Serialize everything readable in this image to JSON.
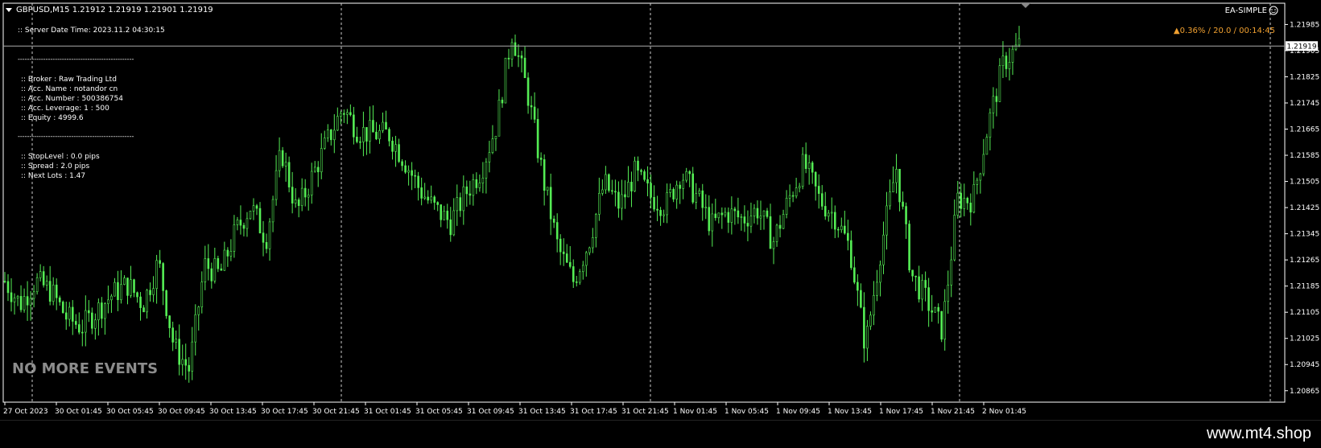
{
  "chart_data": {
    "type": "candlestick",
    "symbol_line": "GBPUSD,M15  1.21912 1.21919 1.21901 1.21919",
    "current_price": 1.21919,
    "current_price_label": "1.21919",
    "ylim": [
      1.2083,
      1.2205
    ],
    "y_ticks": [
      "1.21985",
      "1.21905",
      "1.21825",
      "1.21745",
      "1.21665",
      "1.21585",
      "1.21505",
      "1.21425",
      "1.21345",
      "1.21265",
      "1.21185",
      "1.21105",
      "1.21025",
      "1.20945",
      "1.20865"
    ],
    "x_ticks": [
      "27 Oct 2023",
      "30 Oct 01:45",
      "30 Oct 05:45",
      "30 Oct 09:45",
      "30 Oct 13:45",
      "30 Oct 17:45",
      "30 Oct 21:45",
      "31 Oct 01:45",
      "31 Oct 05:45",
      "31 Oct 09:45",
      "31 Oct 13:45",
      "31 Oct 17:45",
      "31 Oct 21:45",
      "1 Nov 01:45",
      "1 Nov 05:45",
      "1 Nov 09:45",
      "1 Nov 13:45",
      "1 Nov 17:45",
      "1 Nov 21:45",
      "2 Nov 01:45"
    ],
    "closes": [
      1.212,
      1.2113,
      1.212,
      1.2117,
      1.2109,
      1.2106,
      1.2111,
      1.2116,
      1.2119,
      1.2113,
      1.2126,
      1.21,
      1.2093,
      1.2125,
      1.2122,
      1.2135,
      1.2143,
      1.2133,
      1.216,
      1.2141,
      1.2152,
      1.2163,
      1.2173,
      1.2166,
      1.2165,
      1.2165,
      1.2157,
      1.2148,
      1.2142,
      1.2138,
      1.2147,
      1.2154,
      1.2168,
      1.2196,
      1.2178,
      1.2152,
      1.213,
      1.212,
      1.2132,
      1.215,
      1.2143,
      1.2153,
      1.2146,
      1.2143,
      1.2153,
      1.2146,
      1.2137,
      1.2141,
      1.2139,
      1.2142,
      1.2132,
      1.2145,
      1.2156,
      1.2145,
      1.214,
      1.213,
      1.21,
      1.213,
      1.2155,
      1.2122,
      1.2114,
      1.2105,
      1.2145,
      1.2145,
      1.2168,
      1.2187,
      1.2192
    ],
    "annotations": {
      "ea_name": "EA-SIMPLE",
      "ea_icon": "smiley-icon",
      "status": "▲0.36% / 20.0 / 00:14:45",
      "status_color": "#f0a030",
      "watermark": "NO MORE EVENTS",
      "candle_color": "#55ee55"
    },
    "grid": false,
    "legend": "none"
  },
  "info_panel": {
    "server_time": ":: Server Date Time: 2023.11.2   04:30:15",
    "separator": "--------------------------------------------------",
    "account_lines": [
      ":: Broker   :   Raw Trading Ltd",
      ":: Acc. Name  :  notandor cn",
      ":: Acc. Number   :    500386754",
      ":: Acc. Leverage:   1 : 500",
      ":: Equity   :   4999.6"
    ],
    "trade_lines": [
      ":: StopLevel  :   0.0 pips",
      ":: Spread  :   2.0 pips",
      ":: Next Lots  :   1.47"
    ]
  },
  "footer": {
    "site": "www.mt4.shop"
  }
}
